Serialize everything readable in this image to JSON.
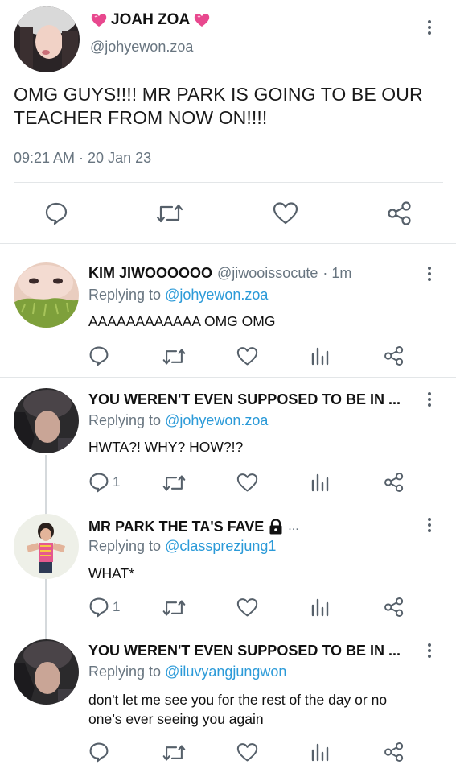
{
  "main_tweet": {
    "display_name": "JOAH ZOA",
    "handle": "@johyewon.zoa",
    "text_line1": "OMG GUYS!!!! MR PARK IS GOING TO BE OUR",
    "text_line2": "TEACHER FROM NOW ON!!!!",
    "timestamp": "09:21 AM · 20 Jan 23",
    "name_decoration": "heart-emoji"
  },
  "replies": [
    {
      "display_name": "KIM JIWOOOOOO",
      "handle": "@jiwooissocute",
      "time": "· 1m",
      "replying_label": "Replying to",
      "replying_to": "@johyewon.zoa",
      "text": "AAAAAAAAAAAA OMG OMG",
      "reply_count": ""
    },
    {
      "display_name": "YOU WEREN'T EVEN SUPPOSED TO BE IN ...",
      "replying_label": "Replying to",
      "replying_to": "@johyewon.zoa",
      "text": "HWTA?! WHY? HOW?!?",
      "reply_count": "1"
    },
    {
      "display_name": "MR PARK THE TA'S FAVE",
      "name_suffix": "...",
      "replying_label": "Replying to",
      "replying_to": "@classprezjung1",
      "text": "WHAT*",
      "reply_count": "1",
      "locked": true
    },
    {
      "display_name": "YOU WEREN'T EVEN SUPPOSED TO BE IN ...",
      "replying_label": "Replying to",
      "replying_to": "@iluvyangjungwon",
      "text_line1": "don't let me see you for the rest of the day or no",
      "text_line2": "one’s ever seeing you again",
      "reply_count": ""
    }
  ],
  "colors": {
    "link": "#2b9ad8",
    "secondary_text": "#687580",
    "icon": "#56606a",
    "divider": "#e3e6e8"
  }
}
